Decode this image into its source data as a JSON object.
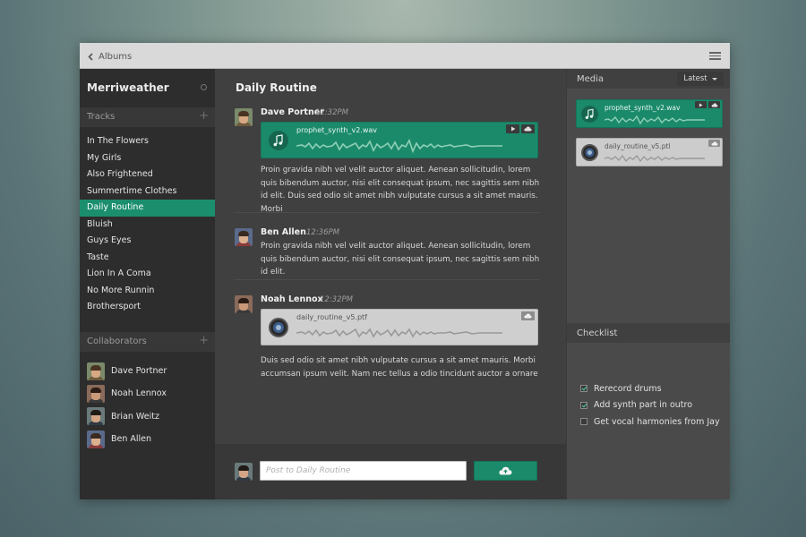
{
  "header": {
    "back_label": "Albums"
  },
  "sidebar": {
    "app_title": "Merriweather",
    "tracks_heading": "Tracks",
    "tracks": [
      {
        "label": "In The Flowers"
      },
      {
        "label": "My Girls"
      },
      {
        "label": "Also Frightened"
      },
      {
        "label": "Summertime Clothes"
      },
      {
        "label": "Daily Routine",
        "active": true
      },
      {
        "label": "Bluish"
      },
      {
        "label": "Guys Eyes"
      },
      {
        "label": "Taste"
      },
      {
        "label": "Lion In A Coma"
      },
      {
        "label": "No More Runnin"
      },
      {
        "label": "Brothersport"
      }
    ],
    "collaborators_heading": "Collaborators",
    "collaborators": [
      {
        "name": "Dave Portner"
      },
      {
        "name": "Noah Lennox"
      },
      {
        "name": "Brian Weitz"
      },
      {
        "name": "Ben Allen"
      }
    ]
  },
  "main": {
    "title": "Daily Routine",
    "posts": [
      {
        "author": "Dave Portner",
        "time": "12:32PM",
        "attachment": {
          "filename": "prophet_synth_v2.wav"
        },
        "body": "Proin gravida nibh vel velit auctor aliquet. Aenean sollicitudin, lorem quis bibendum auctor, nisi elit consequat ipsum, nec sagittis sem nibh id elit. Duis sed odio sit amet nibh vulputate cursus a sit amet mauris. Morbi"
      },
      {
        "author": "Ben Allen",
        "time": "12:36PM",
        "body": "Proin gravida nibh vel velit auctor aliquet. Aenean sollicitudin, lorem quis bibendum auctor, nisi elit consequat ipsum, nec sagittis sem nibh id elit."
      },
      {
        "author": "Noah Lennox",
        "time": "12:32PM",
        "attachment": {
          "filename": "daily_routine_v5.ptf"
        },
        "body": "Duis sed odio sit amet nibh vulputate cursus a sit amet mauris. Morbi accumsan ipsum velit. Nam nec tellus a odio tincidunt auctor a ornare"
      }
    ],
    "composer": {
      "placeholder": "Post to Daily Routine"
    }
  },
  "media": {
    "heading": "Media",
    "sort_label": "Latest",
    "items": [
      {
        "filename": "prophet_synth_v2.wav"
      },
      {
        "filename": "daily_routine_v5.ptl"
      }
    ]
  },
  "checklist": {
    "heading": "Checklist",
    "items": [
      {
        "label": "Rerecord drums",
        "checked": true
      },
      {
        "label": "Add synth part in outro",
        "checked": true
      },
      {
        "label": "Get vocal harmonies from Jay",
        "checked": false
      }
    ]
  },
  "colors": {
    "accent": "#1b8a6b",
    "active_track": "#1b8e6e",
    "sidebar_bg": "#2d2d2d",
    "main_bg": "#404040",
    "topbar_bg": "#d9d9d9"
  }
}
